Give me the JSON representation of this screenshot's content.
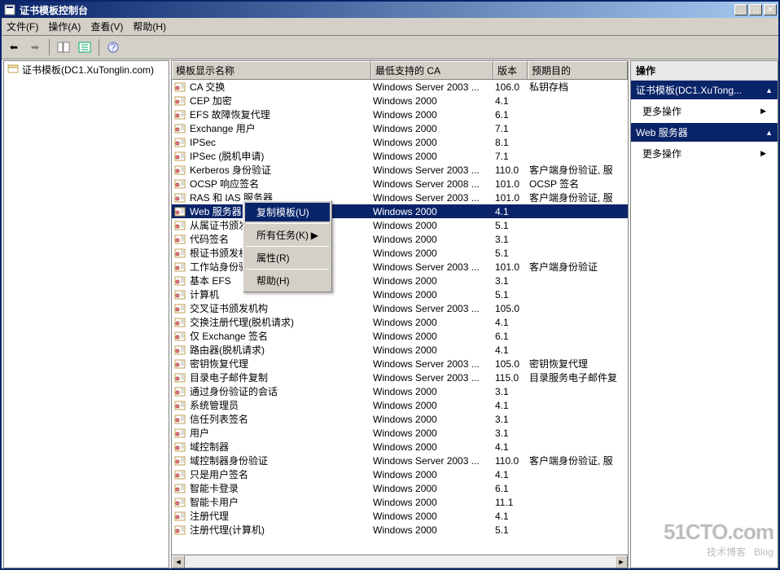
{
  "titlebar": {
    "title": "证书模板控制台"
  },
  "menubar": {
    "file": "文件(F)",
    "action": "操作(A)",
    "view": "查看(V)",
    "help": "帮助(H)"
  },
  "tree": {
    "root": "证书模板(DC1.XuTonglin.com)"
  },
  "columns": {
    "name": "模板显示名称",
    "ca": "最低支持的 CA",
    "ver": "版本",
    "purpose": "预期目的"
  },
  "rows": [
    {
      "name": "CA 交换",
      "ca": "Windows Server 2003 ...",
      "ver": "106.0",
      "purpose": "私钥存档"
    },
    {
      "name": "CEP 加密",
      "ca": "Windows 2000",
      "ver": "4.1",
      "purpose": ""
    },
    {
      "name": "EFS 故障恢复代理",
      "ca": "Windows 2000",
      "ver": "6.1",
      "purpose": ""
    },
    {
      "name": "Exchange 用户",
      "ca": "Windows 2000",
      "ver": "7.1",
      "purpose": ""
    },
    {
      "name": "IPSec",
      "ca": "Windows 2000",
      "ver": "8.1",
      "purpose": ""
    },
    {
      "name": "IPSec (脱机申请)",
      "ca": "Windows 2000",
      "ver": "7.1",
      "purpose": ""
    },
    {
      "name": "Kerberos 身份验证",
      "ca": "Windows Server 2003 ...",
      "ver": "110.0",
      "purpose": "客户端身份验证, 服"
    },
    {
      "name": "OCSP 响应签名",
      "ca": "Windows Server 2008 ...",
      "ver": "101.0",
      "purpose": "OCSP 签名"
    },
    {
      "name": "RAS 和 IAS 服务器",
      "ca": "Windows Server 2003 ...",
      "ver": "101.0",
      "purpose": "客户端身份验证, 服"
    },
    {
      "name": "Web 服务器",
      "ca": "Windows 2000",
      "ver": "4.1",
      "purpose": "",
      "selected": true
    },
    {
      "name": "从属证书颁发机构",
      "ca": "Windows 2000",
      "ver": "5.1",
      "purpose": ""
    },
    {
      "name": "代码签名",
      "ca": "Windows 2000",
      "ver": "3.1",
      "purpose": ""
    },
    {
      "name": "根证书颁发机构",
      "ca": "Windows 2000",
      "ver": "5.1",
      "purpose": ""
    },
    {
      "name": "工作站身份验证",
      "ca": "Windows Server 2003 ...",
      "ver": "101.0",
      "purpose": "客户端身份验证"
    },
    {
      "name": "基本 EFS",
      "ca": "Windows 2000",
      "ver": "3.1",
      "purpose": ""
    },
    {
      "name": "计算机",
      "ca": "Windows 2000",
      "ver": "5.1",
      "purpose": ""
    },
    {
      "name": "交叉证书颁发机构",
      "ca": "Windows Server 2003 ...",
      "ver": "105.0",
      "purpose": ""
    },
    {
      "name": "交换注册代理(脱机请求)",
      "ca": "Windows 2000",
      "ver": "4.1",
      "purpose": ""
    },
    {
      "name": "仅 Exchange 签名",
      "ca": "Windows 2000",
      "ver": "6.1",
      "purpose": ""
    },
    {
      "name": "路由器(脱机请求)",
      "ca": "Windows 2000",
      "ver": "4.1",
      "purpose": ""
    },
    {
      "name": "密钥恢复代理",
      "ca": "Windows Server 2003 ...",
      "ver": "105.0",
      "purpose": "密钥恢复代理"
    },
    {
      "name": "目录电子邮件复制",
      "ca": "Windows Server 2003 ...",
      "ver": "115.0",
      "purpose": "目录服务电子邮件复"
    },
    {
      "name": "通过身份验证的会话",
      "ca": "Windows 2000",
      "ver": "3.1",
      "purpose": ""
    },
    {
      "name": "系统管理员",
      "ca": "Windows 2000",
      "ver": "4.1",
      "purpose": ""
    },
    {
      "name": "信任列表签名",
      "ca": "Windows 2000",
      "ver": "3.1",
      "purpose": ""
    },
    {
      "name": "用户",
      "ca": "Windows 2000",
      "ver": "3.1",
      "purpose": ""
    },
    {
      "name": "域控制器",
      "ca": "Windows 2000",
      "ver": "4.1",
      "purpose": ""
    },
    {
      "name": "域控制器身份验证",
      "ca": "Windows Server 2003 ...",
      "ver": "110.0",
      "purpose": "客户端身份验证, 服"
    },
    {
      "name": "只是用户签名",
      "ca": "Windows 2000",
      "ver": "4.1",
      "purpose": ""
    },
    {
      "name": "智能卡登录",
      "ca": "Windows 2000",
      "ver": "6.1",
      "purpose": ""
    },
    {
      "name": "智能卡用户",
      "ca": "Windows 2000",
      "ver": "11.1",
      "purpose": ""
    },
    {
      "name": "注册代理",
      "ca": "Windows 2000",
      "ver": "4.1",
      "purpose": ""
    },
    {
      "name": "注册代理(计算机)",
      "ca": "Windows 2000",
      "ver": "5.1",
      "purpose": ""
    }
  ],
  "context_menu": {
    "duplicate": "复制模板(U)",
    "all_tasks": "所有任务(K)",
    "properties": "属性(R)",
    "help": "帮助(H)"
  },
  "actions": {
    "header": "操作",
    "section1_title": "证书模板(DC1.XuTong...",
    "more1": "更多操作",
    "section2_title": "Web 服务器",
    "more2": "更多操作"
  },
  "watermark": {
    "big": "51CTO.com",
    "small": "技术博客",
    "blog": "Blog"
  }
}
